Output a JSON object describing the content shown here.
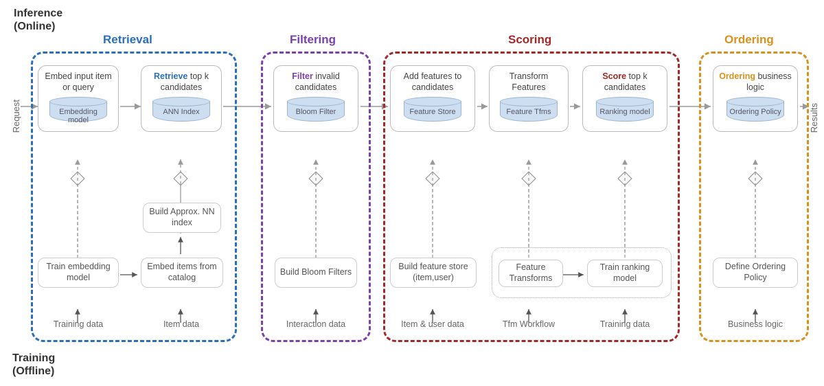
{
  "section_labels": {
    "inference_line1": "Inference",
    "inference_line2": "(Online)",
    "training_line1": "Training",
    "training_line2": "(Offline)"
  },
  "axis": {
    "request": "Request",
    "results": "Results"
  },
  "stages": {
    "retrieval": {
      "title": "Retrieval",
      "color": "#2a6fbf"
    },
    "filtering": {
      "title": "Filtering",
      "color": "#7a3fb0"
    },
    "scoring": {
      "title": "Scoring",
      "color": "#a52828"
    },
    "ordering": {
      "title": "Ordering",
      "color": "#d9901c"
    }
  },
  "nodes": {
    "embed_input": {
      "text": "Embed input item or query",
      "db": "Embedding model"
    },
    "retrieve": {
      "prefix": "Retrieve",
      "rest": " top k candidates",
      "db": "ANN Index"
    },
    "filter": {
      "prefix": "Filter",
      "rest": " invalid candidates",
      "db": "Bloom Filter"
    },
    "add_feat": {
      "text": "Add features to candidates",
      "db": "Feature Store"
    },
    "tfm_feat": {
      "text": "Transform Features",
      "db": "Feature Tfms"
    },
    "score": {
      "prefix": "Score",
      "rest": " top k candidates",
      "db": "Ranking model"
    },
    "ordering": {
      "prefix": "Ordering",
      "rest": " business logic",
      "db": "Ordering Policy"
    }
  },
  "below_boxes": {
    "build_ann": "Build Approx. NN index",
    "train_embed": "Train embedding model",
    "embed_items": "Embed items from catalog",
    "build_bloom": "Build Bloom Filters",
    "build_fs": "Build feature store (item,user)",
    "feat_tfm": "Feature Transforms",
    "train_rank": "Train ranking model",
    "define_order": "Define Ordering Policy"
  },
  "data_labels": {
    "d1": "Training data",
    "d2": "Item data",
    "d3": "Interaction data",
    "d4": "Item & user data",
    "d5": "Tfm Workflow",
    "d6": "Training data",
    "d7": "Business logic"
  }
}
